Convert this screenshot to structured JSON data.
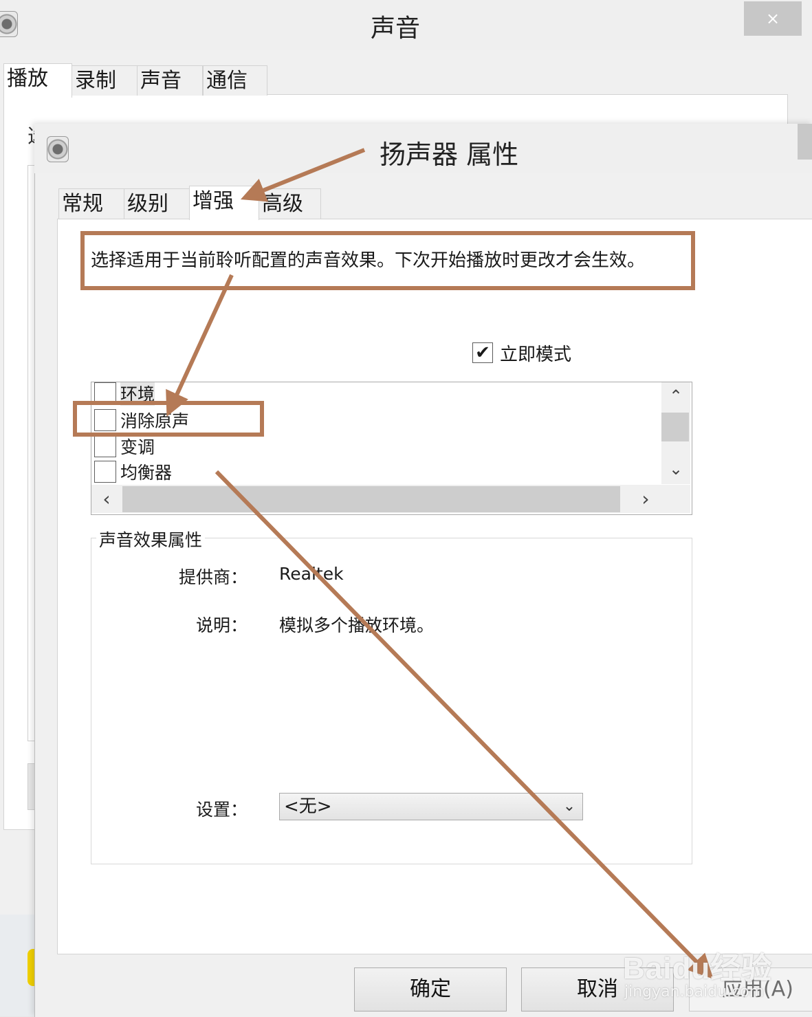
{
  "outer_window": {
    "title": "声音",
    "close_glyph": "×",
    "tabs": [
      {
        "label": "播放",
        "active": true
      },
      {
        "label": "录制",
        "active": false
      },
      {
        "label": "声音",
        "active": false
      },
      {
        "label": "通信",
        "active": false
      }
    ],
    "partial_glyph": "选"
  },
  "dialog": {
    "title": "扬声器 属性",
    "tabs": [
      {
        "label": "常规",
        "active": false
      },
      {
        "label": "级别",
        "active": false
      },
      {
        "label": "增强",
        "active": true
      },
      {
        "label": "高级",
        "active": false
      }
    ],
    "intro": "选择适用于当前聆听配置的声音效果。下次开始播放时更改才会生效。",
    "immediate_mode": {
      "label": "立即模式",
      "checked": true,
      "check_glyph": "✔"
    },
    "effects": [
      {
        "label": "环境",
        "checked": false
      },
      {
        "label": "消除原声",
        "checked": false
      },
      {
        "label": "变调",
        "checked": false
      },
      {
        "label": "均衡器",
        "checked": false
      }
    ],
    "scroll": {
      "up": "⌃",
      "down": "⌄",
      "left": "‹",
      "right": "›"
    },
    "properties": {
      "group_title": "声音效果属性",
      "provider_label": "提供商：",
      "provider_value": "Realtek",
      "description_label": "说明：",
      "description_value": "模拟多个播放环境。",
      "setting_label": "设置：",
      "setting_value": "<无>",
      "dropdown_glyph": "⌄"
    },
    "buttons": {
      "ok": "确定",
      "cancel": "取消",
      "apply": "应用(A)"
    }
  },
  "annotation_color": "#b57a56",
  "watermark": {
    "logo": "Baidu经验",
    "url": "jingyan.baidu.com"
  }
}
